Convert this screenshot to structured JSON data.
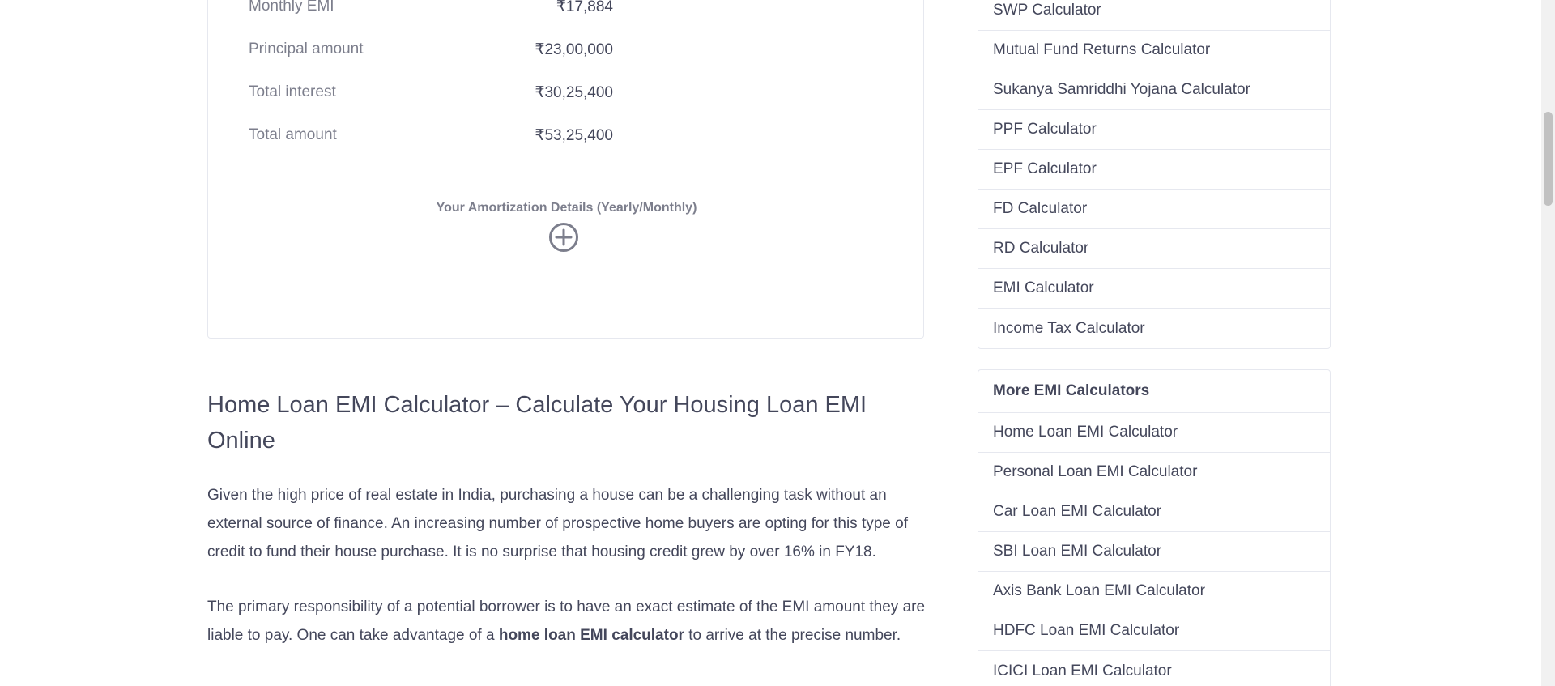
{
  "results": {
    "rows": [
      {
        "label": "Monthly EMI",
        "value": "₹17,884"
      },
      {
        "label": "Principal amount",
        "value": "₹23,00,000"
      },
      {
        "label": "Total interest",
        "value": "₹30,25,400"
      },
      {
        "label": "Total amount",
        "value": "₹53,25,400"
      }
    ],
    "amortization_title": "Your Amortization Details (Yearly/Monthly)"
  },
  "article": {
    "title": "Home Loan EMI Calculator – Calculate Your Housing Loan EMI Online",
    "p1": "Given the high price of real estate in India, purchasing a house can be a challenging task without an external source of finance. An increasing number of prospective home buyers are opting for this type of credit to fund their house purchase. It is no surprise that housing credit grew by over 16% in FY18.",
    "p2_before": "The primary responsibility of a potential borrower is to have an exact estimate of the EMI amount they are liable to pay. One can take advantage of a ",
    "p2_bold": "home loan EMI calculator",
    "p2_after": " to arrive at the precise number."
  },
  "sidebar": {
    "calculators": [
      "SWP Calculator",
      "Mutual Fund Returns Calculator",
      "Sukanya Samriddhi Yojana Calculator",
      "PPF Calculator",
      "EPF Calculator",
      "FD Calculator",
      "RD Calculator",
      "EMI Calculator",
      "Income Tax Calculator"
    ],
    "more_emi_title": "More EMI Calculators",
    "more_emi": [
      "Home Loan EMI Calculator",
      "Personal Loan EMI Calculator",
      "Car Loan EMI Calculator",
      "SBI Loan EMI Calculator",
      "Axis Bank Loan EMI Calculator",
      "HDFC Loan EMI Calculator",
      "ICICI Loan EMI Calculator"
    ]
  },
  "icons": {
    "expand": "plus-circle-icon"
  },
  "colors": {
    "text": "#44475b",
    "muted": "#7c7e8c",
    "border": "#e6e8ef"
  }
}
